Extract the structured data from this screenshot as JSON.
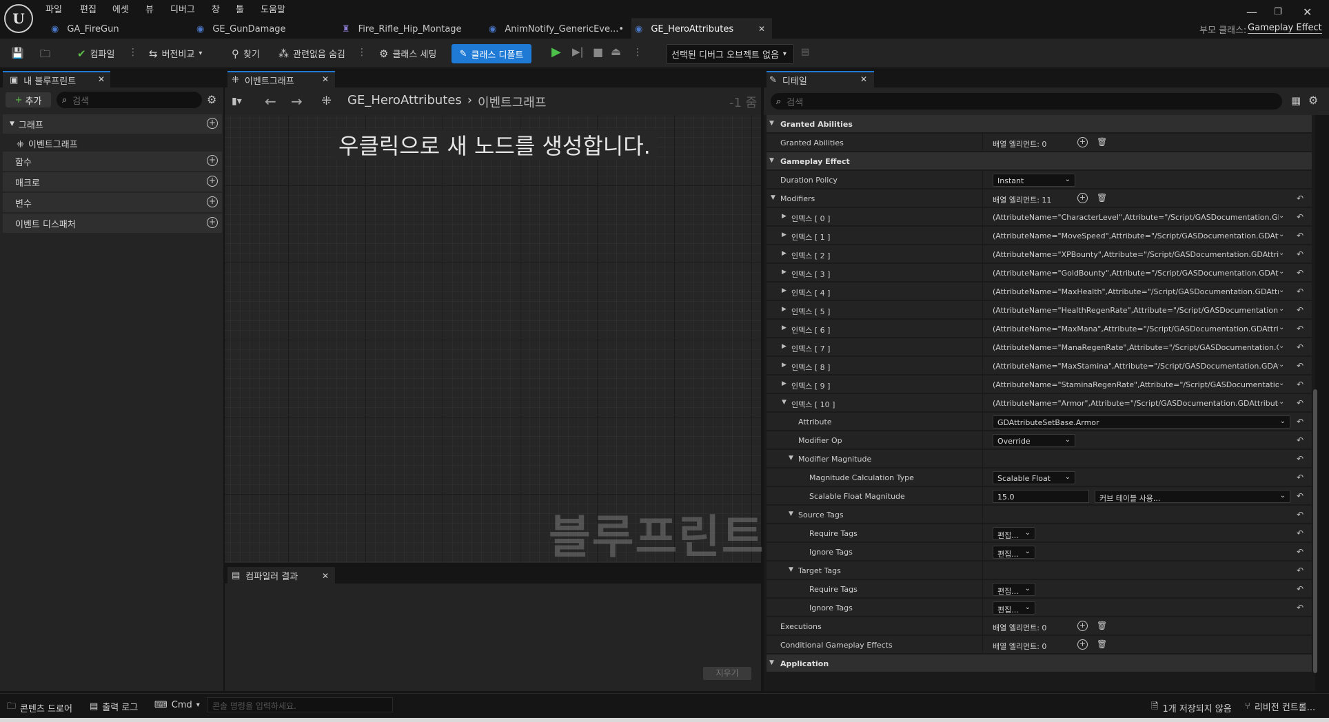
{
  "app": {
    "logo_text": "U",
    "menu": [
      "파일",
      "편집",
      "에셋",
      "뷰",
      "디버그",
      "창",
      "툴",
      "도움말"
    ],
    "tabs": [
      "GA_FireGun",
      "GE_GunDamage",
      "Fire_Rifle_Hip_Montage",
      "AnimNotify_GenericEve...•",
      "GE_HeroAttributes"
    ],
    "parent_class_label": "부모 클래스:",
    "parent_class_value": "Gameplay Effect"
  },
  "toolbar": {
    "compile": "컴파일",
    "diff": "버전비교",
    "find": "찾기",
    "hide_unrelated": "관련없음 숨김",
    "class_settings": "클래스 세팅",
    "class_defaults": "클래스 디폴트",
    "debug_object": "선택된 디버그 오브젝트 없음"
  },
  "my_blueprint": {
    "tab": "내 블루프린트",
    "add": "추가",
    "search_placeholder": "검색",
    "categories": [
      "그래프",
      "함수",
      "매크로",
      "변수",
      "이벤트 디스패처"
    ],
    "graph_item": "이벤트그래프"
  },
  "graph": {
    "tab": "이벤트그래프",
    "breadcrumb_root": "GE_HeroAttributes",
    "breadcrumb_current": "이벤트그래프",
    "zoom": "-1 줌",
    "hint": "우클릭으로 새 노드를 생성합니다.",
    "watermark": "블루프린트"
  },
  "compiler": {
    "tab": "컴파일러 결과",
    "clear": "지우기"
  },
  "details": {
    "tab": "디테일",
    "search_placeholder": "검색",
    "sections": {
      "granted_abilities": "Granted Abilities",
      "gameplay_effect": "Gameplay Effect",
      "application": "Application"
    },
    "granted_abilities_row": {
      "name": "Granted Abilities",
      "value": "배열 엘리먼트: 0"
    },
    "duration_policy": {
      "name": "Duration Policy",
      "value": "Instant"
    },
    "modifiers": {
      "name": "Modifiers",
      "value": "배열 엘리먼트: 11"
    },
    "indices": [
      {
        "label": "인덱스 [ 0 ]",
        "value": "(AttributeName=\"CharacterLevel\",Attribute=\"/Script/GASDocumentation.GDAttri"
      },
      {
        "label": "인덱스 [ 1 ]",
        "value": "(AttributeName=\"MoveSpeed\",Attribute=\"/Script/GASDocumentation.GDAttribu"
      },
      {
        "label": "인덱스 [ 2 ]",
        "value": "(AttributeName=\"XPBounty\",Attribute=\"/Script/GASDocumentation.GDAttribute"
      },
      {
        "label": "인덱스 [ 3 ]",
        "value": "(AttributeName=\"GoldBounty\",Attribute=\"/Script/GASDocumentation.GDAttribut"
      },
      {
        "label": "인덱스 [ 4 ]",
        "value": "(AttributeName=\"MaxHealth\",Attribute=\"/Script/GASDocumentation.GDAttribut"
      },
      {
        "label": "인덱스 [ 5 ]",
        "value": "(AttributeName=\"HealthRegenRate\",Attribute=\"/Script/GASDocumentation.GDA"
      },
      {
        "label": "인덱스 [ 6 ]",
        "value": "(AttributeName=\"MaxMana\",Attribute=\"/Script/GASDocumentation.GDAttribute"
      },
      {
        "label": "인덱스 [ 7 ]",
        "value": "(AttributeName=\"ManaRegenRate\",Attribute=\"/Script/GASDocumentation.GDAt"
      },
      {
        "label": "인덱스 [ 8 ]",
        "value": "(AttributeName=\"MaxStamina\",Attribute=\"/Script/GASDocumentation.GDAttrib"
      },
      {
        "label": "인덱스 [ 9 ]",
        "value": "(AttributeName=\"StaminaRegenRate\",Attribute=\"/Script/GASDocumentation.GD"
      },
      {
        "label": "인덱스 [ 10 ]",
        "value": "(AttributeName=\"Armor\",Attribute=\"/Script/GASDocumentation.GDAttributeSetI"
      }
    ],
    "attribute": {
      "name": "Attribute",
      "value": "GDAttributeSetBase.Armor"
    },
    "modifier_op": {
      "name": "Modifier Op",
      "value": "Override"
    },
    "modifier_magnitude": "Modifier Magnitude",
    "magnitude_calc_type": {
      "name": "Magnitude Calculation Type",
      "value": "Scalable Float"
    },
    "scalable_float_magnitude": {
      "name": "Scalable Float Magnitude",
      "value": "15.0",
      "curve": "커브 테이블 사용..."
    },
    "source_tags": "Source Tags",
    "target_tags": "Target Tags",
    "require_tags": "Require Tags",
    "ignore_tags": "Ignore Tags",
    "edit_label": "편집...",
    "executions": {
      "name": "Executions",
      "value": "배열 엘리먼트: 0"
    },
    "conditional_effects": {
      "name": "Conditional Gameplay Effects",
      "value": "배열 엘리먼트: 0"
    }
  },
  "statusbar": {
    "content_drawer": "콘텐츠 드로어",
    "output_log": "출력 로그",
    "cmd": "Cmd",
    "console_placeholder": "콘솔 명령을 입력하세요.",
    "unsaved": "1개 저장되지 않음",
    "revision_control": "리비전 컨트롤..."
  }
}
